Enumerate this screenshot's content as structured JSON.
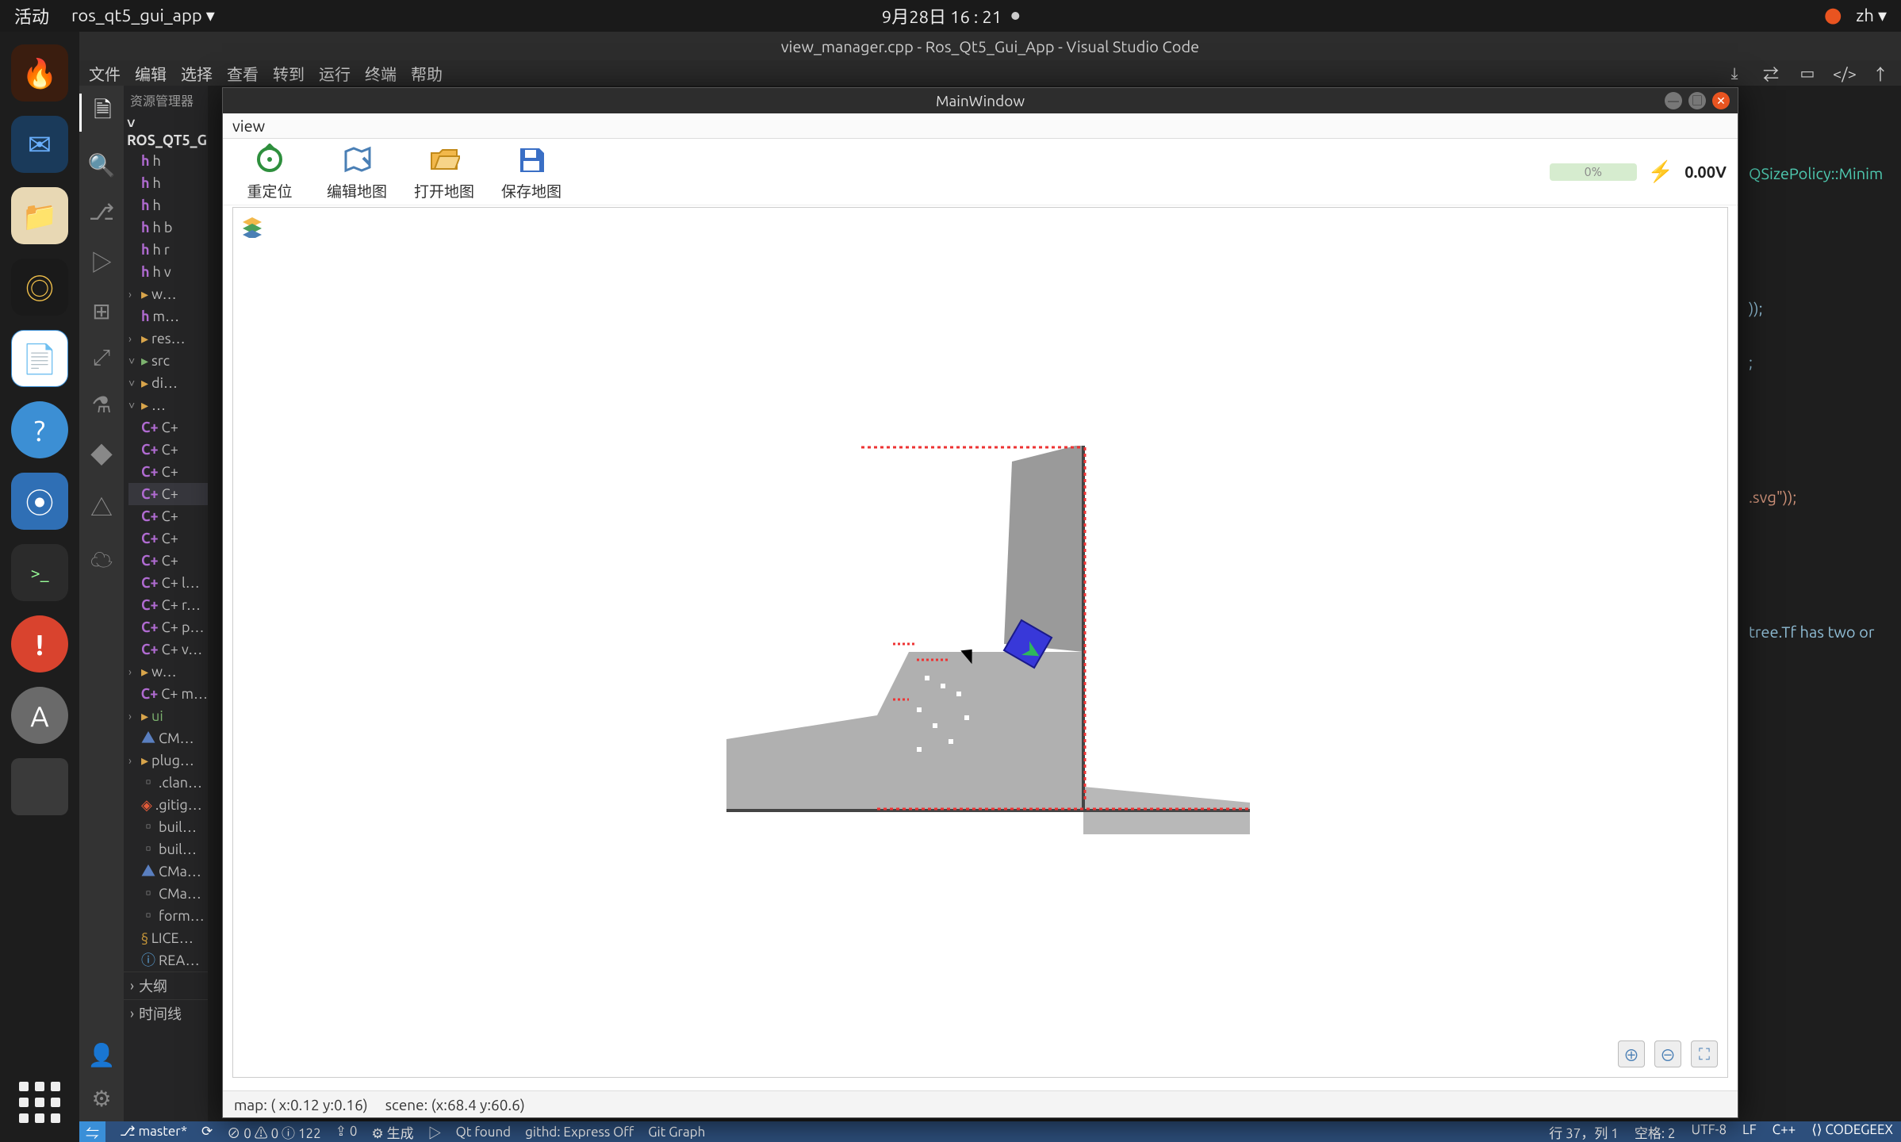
{
  "gnome": {
    "activities": "活动",
    "focused_app": "ros_qt5_gui_app ▾",
    "datetime": "9月28日  16 : 21",
    "lang": "zh ▾"
  },
  "dock": [
    {
      "name": "firefox",
      "bg": "#ffa033",
      "glyph": "🦊"
    },
    {
      "name": "thunderbird",
      "bg": "#2f7de1",
      "glyph": "✉"
    },
    {
      "name": "files",
      "bg": "#e8d8b4",
      "glyph": "📁"
    },
    {
      "name": "rhythmbox",
      "bg": "#2c2c2c",
      "glyph": "◎"
    },
    {
      "name": "libreoffice-writer",
      "bg": "#3c8fd4",
      "glyph": "📄"
    },
    {
      "name": "help",
      "bg": "#3c8fd4",
      "glyph": "?"
    },
    {
      "name": "vscode",
      "bg": "#2f6fb5",
      "glyph": "⦿"
    },
    {
      "name": "terminal",
      "bg": "#2b2b2b",
      "glyph": ">_"
    },
    {
      "name": "crash-report",
      "bg": "#d9432e",
      "glyph": "!"
    },
    {
      "name": "software-updater",
      "bg": "#6a6a6a",
      "glyph": "A"
    }
  ],
  "vscode": {
    "title": "view_manager.cpp - Ros_Qt5_Gui_App - Visual Studio Code",
    "menu": [
      "文件",
      "编辑",
      "选择",
      "查看",
      "转到",
      "运行",
      "终端",
      "帮助"
    ],
    "explorer_label": "资源管理器",
    "root": "ROS_QT5_G…",
    "tree": [
      {
        "t": "h",
        "ico": "h"
      },
      {
        "t": "h",
        "ico": "h"
      },
      {
        "t": "h",
        "ico": "h"
      },
      {
        "t": "h  b",
        "ico": "h"
      },
      {
        "t": "h  r",
        "ico": "h"
      },
      {
        "t": "h  v",
        "ico": "h"
      },
      {
        "t": "w…",
        "ico": "folder",
        "chev": ">"
      },
      {
        "t": "m…",
        "ico": "h"
      },
      {
        "t": "res…",
        "ico": "folder",
        "chev": ">"
      },
      {
        "t": "src",
        "ico": "folder-green",
        "chev": "v"
      },
      {
        "t": "di…",
        "ico": "folder",
        "chev": "v"
      },
      {
        "t": "…",
        "ico": "folder",
        "chev": "v"
      },
      {
        "t": "C+",
        "ico": "cpp"
      },
      {
        "t": "C+",
        "ico": "cpp"
      },
      {
        "t": "C+",
        "ico": "cpp"
      },
      {
        "t": "C+",
        "ico": "cpp",
        "sel": true
      },
      {
        "t": "C+",
        "ico": "cpp"
      },
      {
        "t": "C+",
        "ico": "cpp"
      },
      {
        "t": "C+",
        "ico": "cpp"
      },
      {
        "t": "C+ l…",
        "ico": "cpp"
      },
      {
        "t": "C+ r…",
        "ico": "cpp"
      },
      {
        "t": "C+ p…",
        "ico": "cpp"
      },
      {
        "t": "C+ v…",
        "ico": "cpp"
      },
      {
        "t": "w…",
        "ico": "folder",
        "chev": ">"
      },
      {
        "t": "C+ m…",
        "ico": "cpp"
      },
      {
        "t": "ui",
        "ico": "folder",
        "chev": ">",
        "green": true
      },
      {
        "t": "CM…",
        "ico": "cmake"
      },
      {
        "t": "plug…",
        "ico": "folder",
        "chev": ">"
      },
      {
        "t": ".clan…",
        "ico": "file"
      },
      {
        "t": ".gitig…",
        "ico": "git"
      },
      {
        "t": "buil…",
        "ico": "file"
      },
      {
        "t": "buil…",
        "ico": "file"
      },
      {
        "t": "CMa…",
        "ico": "cmake"
      },
      {
        "t": "CMa…",
        "ico": "file"
      },
      {
        "t": "form…",
        "ico": "file"
      },
      {
        "t": "LICE…",
        "ico": "lic"
      },
      {
        "t": "REA…",
        "ico": "md"
      }
    ],
    "outline": [
      {
        "label": "大纲",
        "chev": ">"
      },
      {
        "label": "时间线",
        "chev": ">"
      }
    ],
    "code_fragments": {
      "size_policy": "QSizePolicy::Minim",
      "paren1": "));",
      "semicolon": ";",
      "svg_str": ".svg\"));",
      "tf_msg": "tree.Tf has two or "
    },
    "status": {
      "remote_icon": "⇋",
      "branch": "master*",
      "sync": "⟳",
      "problems": "⊘ 0 ⚠ 0 ⓘ 122",
      "ports": "⇪ 0",
      "gen": "生成",
      "qt": "Qt found",
      "githd": "githd: Express Off",
      "gitgraph": "Git Graph",
      "pos": "行 37，列 1",
      "spaces": "空格: 2",
      "enc": "UTF-8",
      "eol": "LF",
      "lang": "C++",
      "geex": "CODEGEEX"
    }
  },
  "qt": {
    "title": "MainWindow",
    "menu": [
      "view"
    ],
    "toolbar": [
      {
        "name": "relocate",
        "label": "重定位"
      },
      {
        "name": "edit-map",
        "label": "编辑地图"
      },
      {
        "name": "open-map",
        "label": "打开地图"
      },
      {
        "name": "save-map",
        "label": "保存地图"
      }
    ],
    "battery_pct": "0%",
    "voltage": "0.00V",
    "status": {
      "map": "map:  ( x:0.12 y:0.16)",
      "scene": "scene:  (x:68.4 y:60.6)"
    }
  }
}
